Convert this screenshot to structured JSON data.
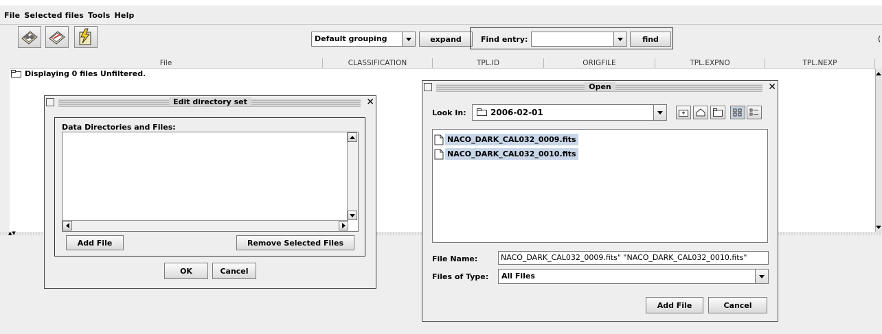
{
  "menu": [
    "File",
    "Selected files",
    "Tools",
    "Help"
  ],
  "toolbar": {
    "icons": [
      "filter-grouping-icon",
      "tag-files-icon",
      "fast-reduce-icon"
    ],
    "grouping_value": "Default grouping",
    "expand_label": "expand",
    "find_entry_label": "Find entry:",
    "find_entry_value": "",
    "find_label": "find",
    "right_cut_char": "("
  },
  "table": {
    "columns": [
      "File",
      "CLASSIFICATION",
      "TPL.ID",
      "ORIGFILE",
      "TPL.EXPNO",
      "TPL.NEXP"
    ],
    "status": "Displaying 0 files Unfiltered."
  },
  "edit_dialog": {
    "title": "Edit directory set",
    "group_label": "Data Directories and Files:",
    "add_file": "Add File",
    "remove_selected": "Remove Selected Files",
    "ok": "OK",
    "cancel": "Cancel"
  },
  "open_dialog": {
    "title": "Open",
    "look_in_label": "Look In:",
    "look_in_value": "2006-02-01",
    "files": [
      "NACO_DARK_CAL032_0009.fits",
      "NACO_DARK_CAL032_0010.fits"
    ],
    "file_name_label": "File Name:",
    "file_name_value": "NACO_DARK_CAL032_0009.fits\" \"NACO_DARK_CAL032_0010.fits\"",
    "files_of_type_label": "Files of Type:",
    "files_of_type_value": "All Files",
    "add_file": "Add File",
    "cancel": "Cancel"
  }
}
